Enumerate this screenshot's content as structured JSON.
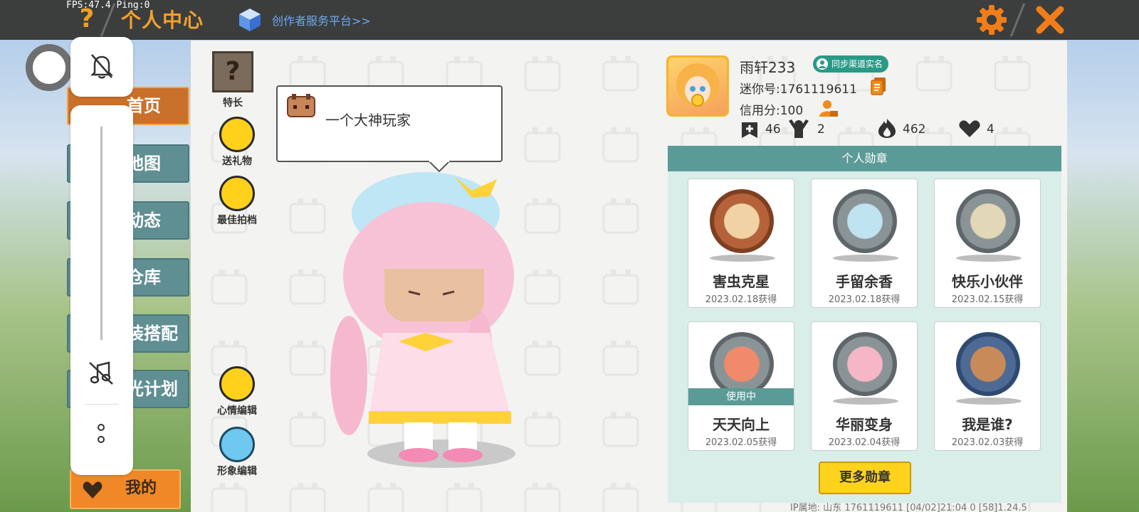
{
  "status": {
    "fps_ping": "FPS:47.4  Ping:0"
  },
  "header": {
    "help_label": "?",
    "title": "个人中心",
    "creator_link": "创作者服务平台>>"
  },
  "tabs": [
    {
      "label": "首页"
    },
    {
      "label": "地图"
    },
    {
      "label": "动态"
    },
    {
      "label": "仓库"
    },
    {
      "label": "装搭配"
    },
    {
      "label": "光计划"
    }
  ],
  "mine": {
    "label": "我的"
  },
  "actions": {
    "specialty": "特长",
    "gift": "送礼物",
    "partner": "最佳拍档",
    "mood": "心情编辑",
    "look": "形象编辑"
  },
  "bubble": {
    "text": "一个大神玩家"
  },
  "profile": {
    "name": "雨轩233",
    "sync_badge": "同步渠道实名",
    "mini_id": "迷你号:1761119611",
    "credit": "信用分:100",
    "stats": {
      "maps": "46",
      "fans": "2",
      "heat": "462",
      "likes": "4"
    }
  },
  "medals": {
    "title": "个人勋章",
    "items": [
      {
        "name": "害虫克星",
        "date": "2023.02.18获得",
        "color": "#b5623a"
      },
      {
        "name": "手留余香",
        "date": "2023.02.18获得",
        "color": "#8a9497"
      },
      {
        "name": "快乐小伙伴",
        "date": "2023.02.15获得",
        "color": "#8a9497"
      },
      {
        "name": "天天向上",
        "date": "2023.02.05获得",
        "color": "#8a9497",
        "in_use": "使用中"
      },
      {
        "name": "华丽变身",
        "date": "2023.02.04获得",
        "color": "#8a9497"
      },
      {
        "name": "我是谁?",
        "date": "2023.02.03获得",
        "color": "#4c6a94"
      }
    ],
    "more_label": "更多勋章"
  },
  "footer": {
    "text": "IP属地: 山东  1761119611   [04/02]21:04 0  [58]1.24.5"
  },
  "colors": {
    "accent": "#f08828",
    "teal": "#5b9b97",
    "topbar": "#3b3e3c"
  }
}
